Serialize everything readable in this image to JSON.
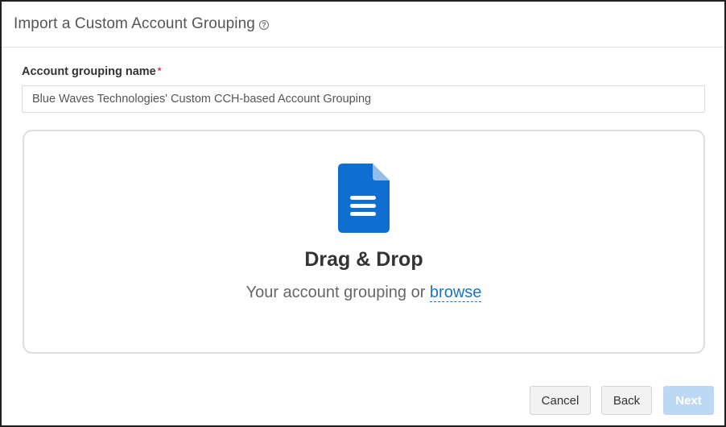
{
  "dialog": {
    "title": "Import a Custom Account Grouping",
    "help_icon": "question-circle-icon"
  },
  "form": {
    "name_label": "Account grouping name",
    "required_mark": "*",
    "name_value": "Blue Waves Technologies' Custom CCH-based Account Grouping"
  },
  "dropzone": {
    "icon": "document-icon",
    "title": "Drag & Drop",
    "subtitle_prefix": "Your account grouping or",
    "browse_label": "browse"
  },
  "footer": {
    "cancel_label": "Cancel",
    "back_label": "Back",
    "next_label": "Next"
  },
  "colors": {
    "accent": "#1a73c8",
    "icon_blue": "#0f6fd1",
    "next_disabled": "#bcd8f3",
    "required": "#d9322b"
  }
}
